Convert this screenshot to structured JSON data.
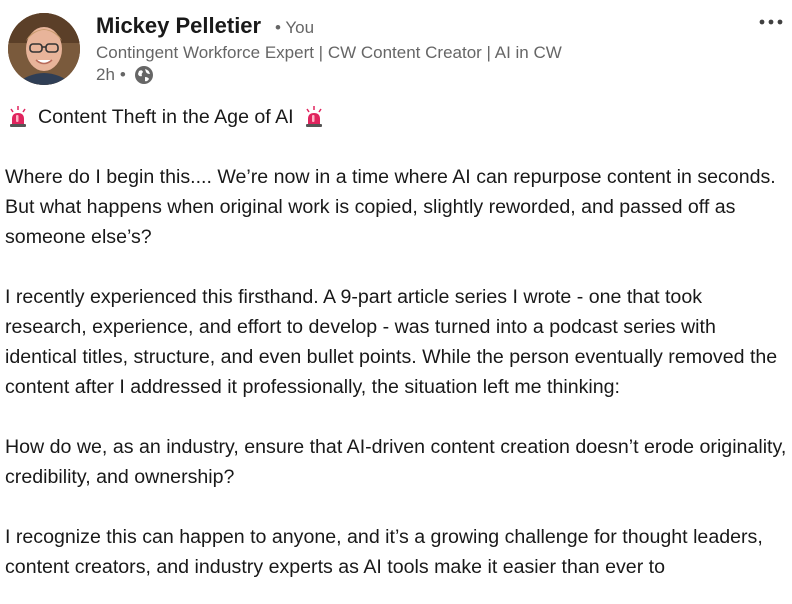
{
  "post": {
    "author": {
      "name": "Mickey Pelletier",
      "connection": "• You",
      "headline": "Contingent Workforce Expert | CW Content Creator | AI in CW",
      "time": "2h",
      "time_separator": "•",
      "visibility_icon": "globe-icon"
    },
    "menu_icon": "more-horizontal-icon",
    "title": "Content Theft in the Age of AI",
    "title_icon": "siren-emoji-icon",
    "paragraphs": [
      "Where do I begin this.... We’re now in a time where AI can repurpose content in seconds. But what happens when original work is copied, slightly reworded, and passed off as someone else’s?",
      "I recently experienced this firsthand. A 9-part article series I wrote - one that took research, experience, and effort to develop - was turned into a podcast series with identical titles, structure, and even bullet points. While the person eventually removed the content after I addressed it professionally, the situation left me thinking:",
      "How do we, as an industry, ensure that AI-driven content creation doesn’t erode originality, credibility, and ownership?",
      "I recognize this can happen to anyone, and it’s a growing challenge for thought leaders, content creators, and industry experts as AI tools make it easier than ever to"
    ]
  },
  "colors": {
    "text_primary": "#191919",
    "text_secondary": "#666666",
    "siren_red": "#e0245e"
  }
}
